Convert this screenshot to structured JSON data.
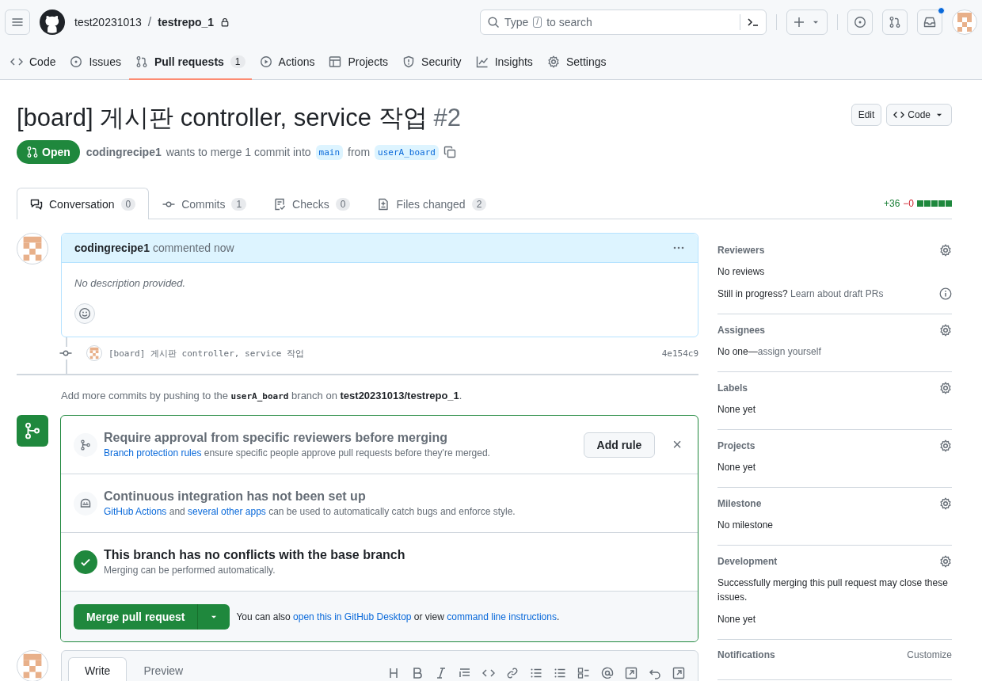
{
  "header": {
    "owner": "test20231013",
    "separator": "/",
    "repo": "testrepo_1",
    "search": {
      "before": "Type",
      "key": "/",
      "after": "to search"
    },
    "inbox_unread": true
  },
  "repo_tabs": [
    {
      "label": "Code",
      "selected": false
    },
    {
      "label": "Issues",
      "selected": false
    },
    {
      "label": "Pull requests",
      "count": "1",
      "selected": true
    },
    {
      "label": "Actions",
      "selected": false
    },
    {
      "label": "Projects",
      "selected": false
    },
    {
      "label": "Security",
      "selected": false
    },
    {
      "label": "Insights",
      "selected": false
    },
    {
      "label": "Settings",
      "selected": false
    }
  ],
  "pr": {
    "title": "[board] 게시판 controller, service 작업",
    "number": "#2",
    "state": "Open",
    "author": "codingrecipe1",
    "merge_text": "wants to merge 1 commit into",
    "base": "main",
    "from_text": "from",
    "head": "userA_board",
    "buttons": [
      "Edit",
      "Code"
    ]
  },
  "pr_tabs": [
    {
      "label": "Conversation",
      "count": "0",
      "selected": true
    },
    {
      "label": "Commits",
      "count": "1",
      "selected": false
    },
    {
      "label": "Checks",
      "count": "0",
      "selected": false
    },
    {
      "label": "Files changed",
      "count": "2",
      "selected": false
    }
  ],
  "diffstat": {
    "additions": "+36",
    "deletions": "−0"
  },
  "comment": {
    "author": "codingrecipe1",
    "action": "commented now",
    "body": "No description provided."
  },
  "commit": {
    "message": "[board] 게시판 controller, service 작업",
    "sha": "4e154c9"
  },
  "push_hint": [
    {
      "kind": "text",
      "text": "Add more commits by pushing to the "
    },
    {
      "kind": "code",
      "text": "userA_board"
    },
    {
      "kind": "text",
      "text": " branch on "
    },
    {
      "kind": "bold",
      "text": "test20231013/testrepo_1"
    },
    {
      "kind": "text",
      "text": "."
    }
  ],
  "merge_sections": [
    {
      "kind": "rule",
      "title": "Require approval from specific reviewers before merging",
      "description": [
        {
          "kind": "link",
          "text": "Branch protection rules"
        },
        {
          "kind": "text",
          "text": " ensure specific people approve pull requests before they're merged."
        }
      ],
      "button": "Add rule",
      "dismiss": "×"
    },
    {
      "kind": "ci",
      "title": "Continuous integration has not been set up",
      "description": [
        {
          "kind": "link",
          "text": "GitHub Actions"
        },
        {
          "kind": "text",
          "text": " and "
        },
        {
          "kind": "link",
          "text": "several other apps"
        },
        {
          "kind": "text",
          "text": " can be used to automatically catch bugs and enforce style."
        }
      ]
    },
    {
      "kind": "status",
      "title": "This branch has no conflicts with the base branch",
      "description": [
        {
          "kind": "text",
          "text": "Merging can be performed automatically."
        }
      ]
    }
  ],
  "merge_footer": {
    "button": "Merge pull request",
    "note": [
      {
        "kind": "text",
        "text": "You can also "
      },
      {
        "kind": "link",
        "text": "open this in GitHub Desktop"
      },
      {
        "kind": "text",
        "text": " or view "
      },
      {
        "kind": "link",
        "text": "command line instructions"
      },
      {
        "kind": "text",
        "text": "."
      }
    ]
  },
  "sidebar": [
    {
      "heading": "Reviewers",
      "gear": true,
      "lines": [
        [
          {
            "kind": "text",
            "text": "No reviews"
          }
        ],
        [
          {
            "kind": "text",
            "text": "Still in progress? "
          },
          {
            "kind": "muted_link",
            "text": "Learn about draft PRs"
          }
        ]
      ],
      "info": true
    },
    {
      "heading": "Assignees",
      "gear": true,
      "lines": [
        [
          {
            "kind": "text",
            "text": "No one—"
          },
          {
            "kind": "muted_link",
            "text": "assign yourself"
          }
        ]
      ]
    },
    {
      "heading": "Labels",
      "gear": true,
      "lines": [
        [
          {
            "kind": "text",
            "text": "None yet"
          }
        ]
      ]
    },
    {
      "heading": "Projects",
      "gear": true,
      "lines": [
        [
          {
            "kind": "text",
            "text": "None yet"
          }
        ]
      ]
    },
    {
      "heading": "Milestone",
      "gear": true,
      "lines": [
        [
          {
            "kind": "text",
            "text": "No milestone"
          }
        ]
      ]
    },
    {
      "heading": "Development",
      "gear": true,
      "lines": [
        [
          {
            "kind": "text",
            "text": "Successfully merging this pull request may close these issues."
          }
        ],
        [
          {
            "kind": "text",
            "text": "None yet"
          }
        ]
      ]
    },
    {
      "heading": "Notifications",
      "gear": false,
      "action": "Customize"
    }
  ],
  "new_comment": {
    "tabs": [
      {
        "label": "Write",
        "selected": true
      },
      {
        "label": "Preview",
        "selected": false
      }
    ]
  }
}
